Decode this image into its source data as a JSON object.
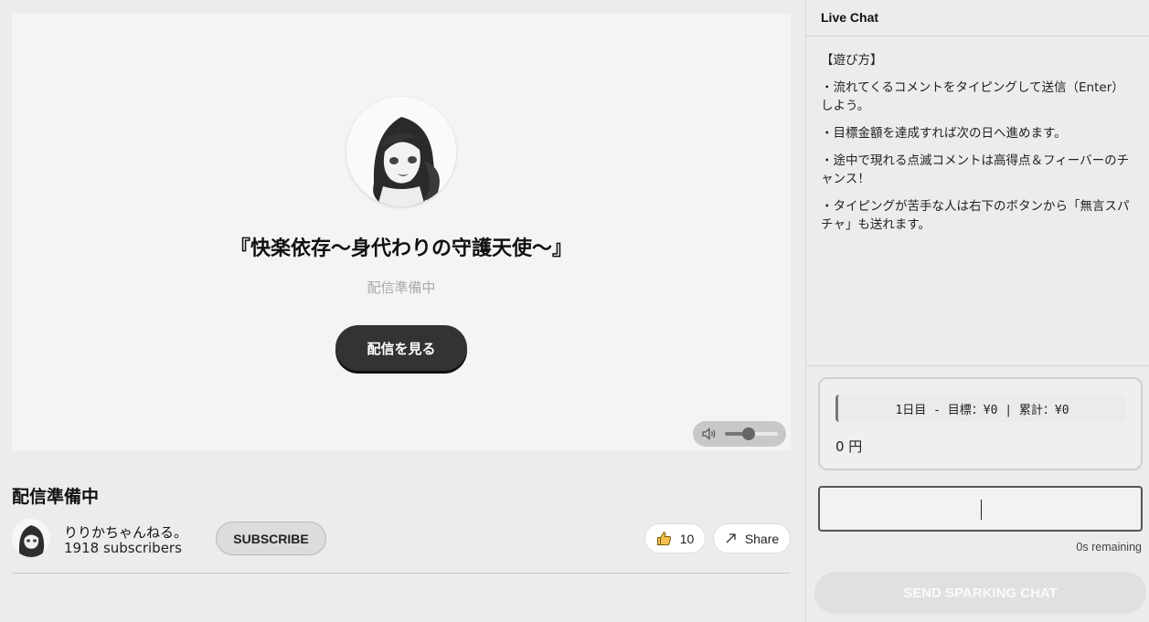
{
  "player": {
    "stream_title": "『快楽依存〜身代わりの守護天使〜』",
    "status": "配信準備中",
    "watch_button": "配信を見る",
    "volume_level": 0.45
  },
  "video_info": {
    "title": "配信準備中",
    "channel_name": "りりかちゃんねる。",
    "subscribers": "1918 subscribers",
    "subscribe_label": "SUBSCRIBE",
    "like_count": "10",
    "share_label": "Share"
  },
  "chat": {
    "header": "Live Chat",
    "messages": [
      "【遊び方】",
      "・流れてくるコメントをタイピングして送信（Enter）しよう。",
      "・目標金額を達成すれば次の日へ進めます。",
      "・途中で現れる点滅コメントは高得点＆フィーバーのチャンス！",
      "・タイピングが苦手な人は右下のボタンから「無言スパチャ」も送れます。"
    ],
    "goal_line": "1日目 - 目標：¥0 | 累計：¥0",
    "amount": "0 円",
    "input_value": "",
    "time_remaining": "0s remaining",
    "send_button": "SEND SPARKING CHAT"
  }
}
